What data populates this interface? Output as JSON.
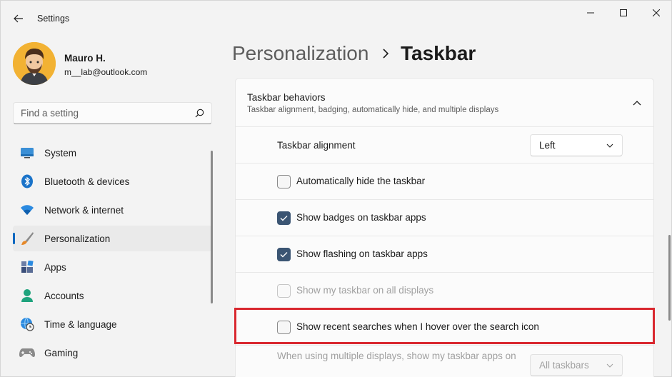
{
  "window": {
    "title": "Settings"
  },
  "profile": {
    "name": "Mauro H.",
    "email": "m__lab@outlook.com"
  },
  "search": {
    "placeholder": "Find a setting"
  },
  "nav": {
    "items": [
      {
        "label": "System",
        "icon": "monitor-icon"
      },
      {
        "label": "Bluetooth & devices",
        "icon": "bluetooth-icon"
      },
      {
        "label": "Network & internet",
        "icon": "wifi-icon"
      },
      {
        "label": "Personalization",
        "icon": "brush-icon",
        "active": true
      },
      {
        "label": "Apps",
        "icon": "apps-icon"
      },
      {
        "label": "Accounts",
        "icon": "person-icon"
      },
      {
        "label": "Time & language",
        "icon": "globe-clock-icon"
      },
      {
        "label": "Gaming",
        "icon": "gamepad-icon"
      }
    ]
  },
  "breadcrumb": {
    "parent": "Personalization",
    "separator": ">",
    "current": "Taskbar"
  },
  "section": {
    "title": "Taskbar behaviors",
    "description": "Taskbar alignment, badging, automatically hide, and multiple displays"
  },
  "settings": {
    "alignment": {
      "label": "Taskbar alignment",
      "value": "Left"
    },
    "auto_hide": {
      "label": "Automatically hide the taskbar",
      "checked": false
    },
    "badges": {
      "label": "Show badges on taskbar apps",
      "checked": true
    },
    "flashing": {
      "label": "Show flashing on taskbar apps",
      "checked": true
    },
    "all_displays": {
      "label": "Show my taskbar on all displays",
      "checked": false,
      "disabled": true
    },
    "recent_searches": {
      "label": "Show recent searches when I hover over the search icon",
      "checked": false
    },
    "multi_display": {
      "label": "When using multiple displays, show my taskbar apps on",
      "value": "All taskbars",
      "disabled": true
    }
  },
  "colors": {
    "accent": "#0067c0",
    "checked": "#3b5573",
    "highlight": "#d9282f"
  }
}
